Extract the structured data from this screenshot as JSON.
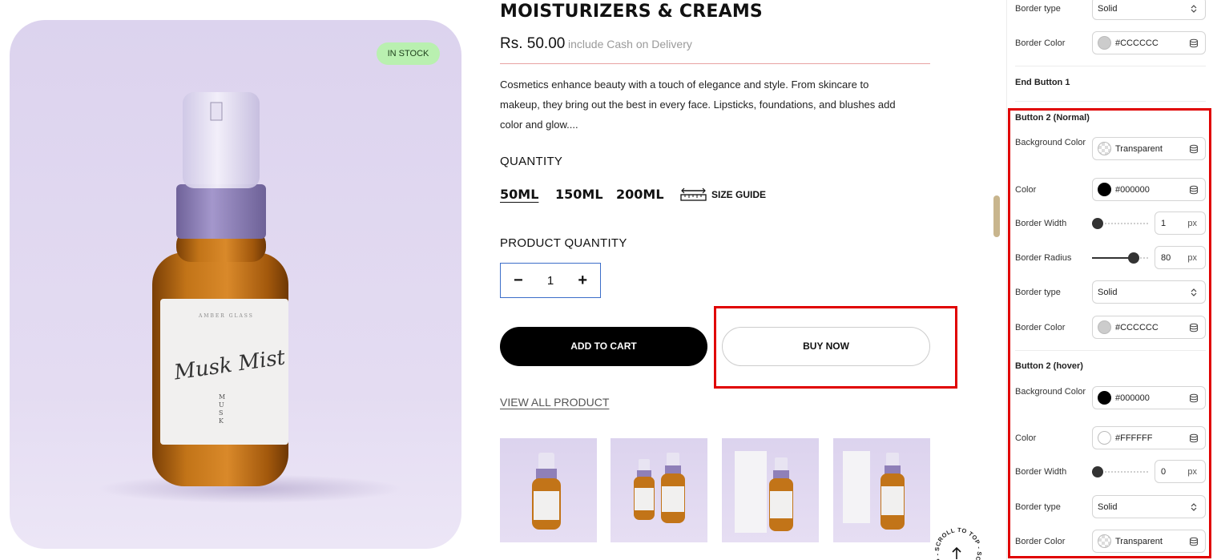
{
  "product": {
    "title": "MOISTURIZERS & CREAMS",
    "stock_badge": "IN STOCK",
    "price": "Rs. 50.00",
    "price_note": "include Cash on Delivery",
    "description": "Cosmetics enhance beauty with a touch of elegance and style. From skincare to makeup, they bring out the best in every face. Lipsticks, foundations, and blushes add color and glow....",
    "quantity_label": "QUANTITY",
    "sizes": [
      "50ML",
      "150ML",
      "200ML"
    ],
    "size_guide": "SIZE GUIDE",
    "product_quantity_label": "PRODUCT QUANTITY",
    "quantity_value": "1",
    "minus": "−",
    "plus": "+",
    "add_to_cart": "ADD TO CART",
    "buy_now": "BUY NOW",
    "view_all": "VIEW ALL PRODUCT",
    "bottle_label_top": "AMBER GLASS",
    "bottle_label_script": "Musk Mist",
    "bottle_label_vertical": "MUSK",
    "scroll_text": "SCROLL TO TOP - SCROLL TO TOP -"
  },
  "panel": {
    "top": {
      "border_type_label": "Border type",
      "border_type_value": "Solid",
      "border_color_label": "Border Color",
      "border_color_value": "#CCCCCC",
      "end_label": "End Button 1"
    },
    "normal": {
      "title": "Button 2 (Normal)",
      "bg_label": "Background Color",
      "bg_value": "Transparent",
      "color_label": "Color",
      "color_value": "#000000",
      "bw_label": "Border Width",
      "bw_value": "1",
      "bw_unit": "px",
      "bw_level": 0.0,
      "br_label": "Border Radius",
      "br_value": "80",
      "br_unit": "px",
      "br_level": 0.8,
      "bt_label": "Border type",
      "bt_value": "Solid",
      "bc_label": "Border Color",
      "bc_value": "#CCCCCC"
    },
    "hover": {
      "title": "Button 2 (hover)",
      "bg_label": "Background Color",
      "bg_value": "#000000",
      "color_label": "Color",
      "color_value": "#FFFFFF",
      "bw_label": "Border Width",
      "bw_value": "0",
      "bw_unit": "px",
      "bw_level": 0.0,
      "bt_label": "Border type",
      "bt_value": "Solid",
      "bc_label": "Border Color",
      "bc_value": "Transparent"
    }
  },
  "colors": {
    "highlight": "#e00000",
    "stock_badge": "#b9f0b0",
    "hero_bg": "#dcd3ee",
    "amber": "#b8680f",
    "cap": "#8f80b8"
  },
  "icons": [
    "ruler-icon",
    "database-icon",
    "chevron-updown-icon",
    "arrow-up-icon"
  ]
}
